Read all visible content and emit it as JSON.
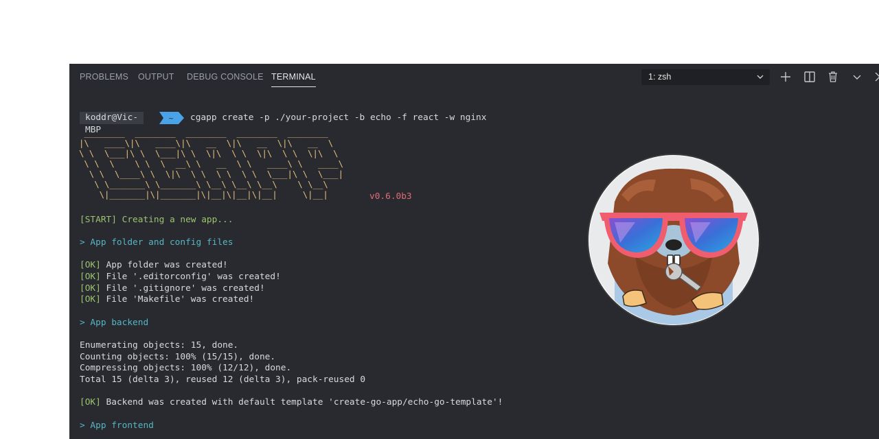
{
  "tabs": [
    {
      "label": "PROBLEMS",
      "active": false
    },
    {
      "label": "OUTPUT",
      "active": false
    },
    {
      "label": "DEBUG CONSOLE",
      "active": false
    },
    {
      "label": "TERMINAL",
      "active": true
    }
  ],
  "terminal_select": {
    "value": "1: zsh"
  },
  "toolbar_icons": [
    "plus-icon",
    "split-icon",
    "trash-icon",
    "chevron-down-icon",
    "close-icon"
  ],
  "prompt": {
    "user": "koddr@Vic-MBP",
    "dir": "~",
    "command": "cgapp create -p ./your-project -b echo -f react -w nginx"
  },
  "logo": {
    "ascii": " ________  ________  ________  ________  ________\n|\\   ____\\|\\   ____\\|\\   __  \\|\\   __  \\|\\   __  \\\n\\ \\  \\___|\\ \\  \\___|\\ \\  \\|\\  \\ \\  \\|\\  \\ \\  \\|\\  \\\n \\ \\  \\    \\ \\  \\  __\\ \\   __  \\ \\   ____\\ \\   ____\\\n  \\ \\  \\____\\ \\  \\|\\  \\ \\  \\ \\  \\ \\  \\___|\\ \\  \\___|\n   \\ \\_______\\ \\_______\\ \\__\\ \\__\\ \\__\\    \\ \\__\\\n    \\|_______|\\|_______|\\|__|\\|__|\\|__|     \\|__|",
    "version": "v0.6.0b3"
  },
  "lines": [
    {
      "text": "[START] Creating a new app...",
      "color": "green"
    },
    {
      "text": "> App folder and config files",
      "color": "cyan"
    },
    {
      "tag": "[OK]",
      "text": " App folder was created!"
    },
    {
      "tag": "[OK]",
      "text": " File '.editorconfig' was created!"
    },
    {
      "tag": "[OK]",
      "text": " File '.gitignore' was created!"
    },
    {
      "tag": "[OK]",
      "text": " File 'Makefile' was created!"
    },
    {
      "text": "> App backend",
      "color": "cyan"
    },
    {
      "text": "Enumerating objects: 15, done.",
      "color": "white"
    },
    {
      "text": "Counting objects: 100% (15/15), done.",
      "color": "white"
    },
    {
      "text": "Compressing objects: 100% (12/12), done.",
      "color": "white"
    },
    {
      "text": "Total 15 (delta 3), reused 12 (delta 3), pack-reused 0",
      "color": "white"
    },
    {
      "tag": "[OK]",
      "text": " Backend was created with default template 'create-go-app/echo-go-template'!"
    },
    {
      "text": "> App frontend",
      "color": "cyan"
    }
  ],
  "colors": {
    "panel_bg": "#282a30",
    "accent_blue": "#4aa3e8",
    "green": "#9cc46e",
    "cyan": "#56b6c2",
    "yellow": "#e5c07b",
    "red": "#e06c75"
  }
}
